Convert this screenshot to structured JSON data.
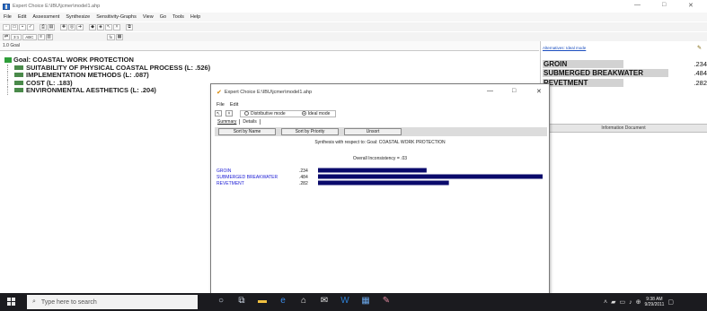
{
  "window": {
    "title": "Expert Choice   E:\\IBU\\jcmer\\model1.ahp",
    "controls": [
      "—",
      "□",
      "✕"
    ]
  },
  "menu": [
    "File",
    "Edit",
    "Assessment",
    "Synthesize",
    "Sensitivity-Graphs",
    "View",
    "Go",
    "Tools",
    "Help"
  ],
  "toolbar2": {
    "labels": [
      "3:1",
      "ABC",
      "fx"
    ]
  },
  "path": "1.0 Goal",
  "tree": {
    "goal": "Goal: COASTAL WORK PROTECTION",
    "children": [
      "SUITABILITY OF PHYSICAL COASTAL PROCESS (L: .526)",
      "IMPLEMENTATION METHODS (L: .087)",
      "COST (L: .183)",
      "ENVIRONMENTAL AESTHETICS (L: .204)"
    ]
  },
  "right": {
    "link": "Alternatives: Ideal mode",
    "alternatives": [
      {
        "name": "GROIN",
        "value": ".234"
      },
      {
        "name": "SUBMERGED BREAKWATER",
        "value": ".484"
      },
      {
        "name": "REVETMENT",
        "value": ".282"
      }
    ],
    "info_header": "Information Document"
  },
  "dialog": {
    "title": "Expert Choice   E:\\IBU\\jcmer\\model1.ahp",
    "menu": [
      "File",
      "Edit"
    ],
    "opt_distributive": "Distributive mode",
    "opt_ideal": "Ideal mode",
    "tabs": [
      "Summary",
      "Details"
    ],
    "buttons": [
      "Sort by Name",
      "Sort by Priority",
      "Unsort"
    ],
    "synthesis": "Synthesis with respect to: Goal: COASTAL WORK PROTECTION",
    "inconsistency": "Overall Inconsistency = .03"
  },
  "chart_data": {
    "type": "bar",
    "categories": [
      "GROIN",
      "SUBMERGED BREAKWATER",
      "REVETMENT"
    ],
    "values": [
      0.234,
      0.484,
      0.282
    ],
    "value_labels": [
      ".234",
      ".484",
      ".282"
    ],
    "xlim": [
      0,
      0.484
    ],
    "bar_color": "#0a0a6b",
    "label_color": "#1a1ad4"
  },
  "taskbar": {
    "search_placeholder": "Type here to search",
    "time": "9:38 AM",
    "date": "9/29/2011"
  }
}
